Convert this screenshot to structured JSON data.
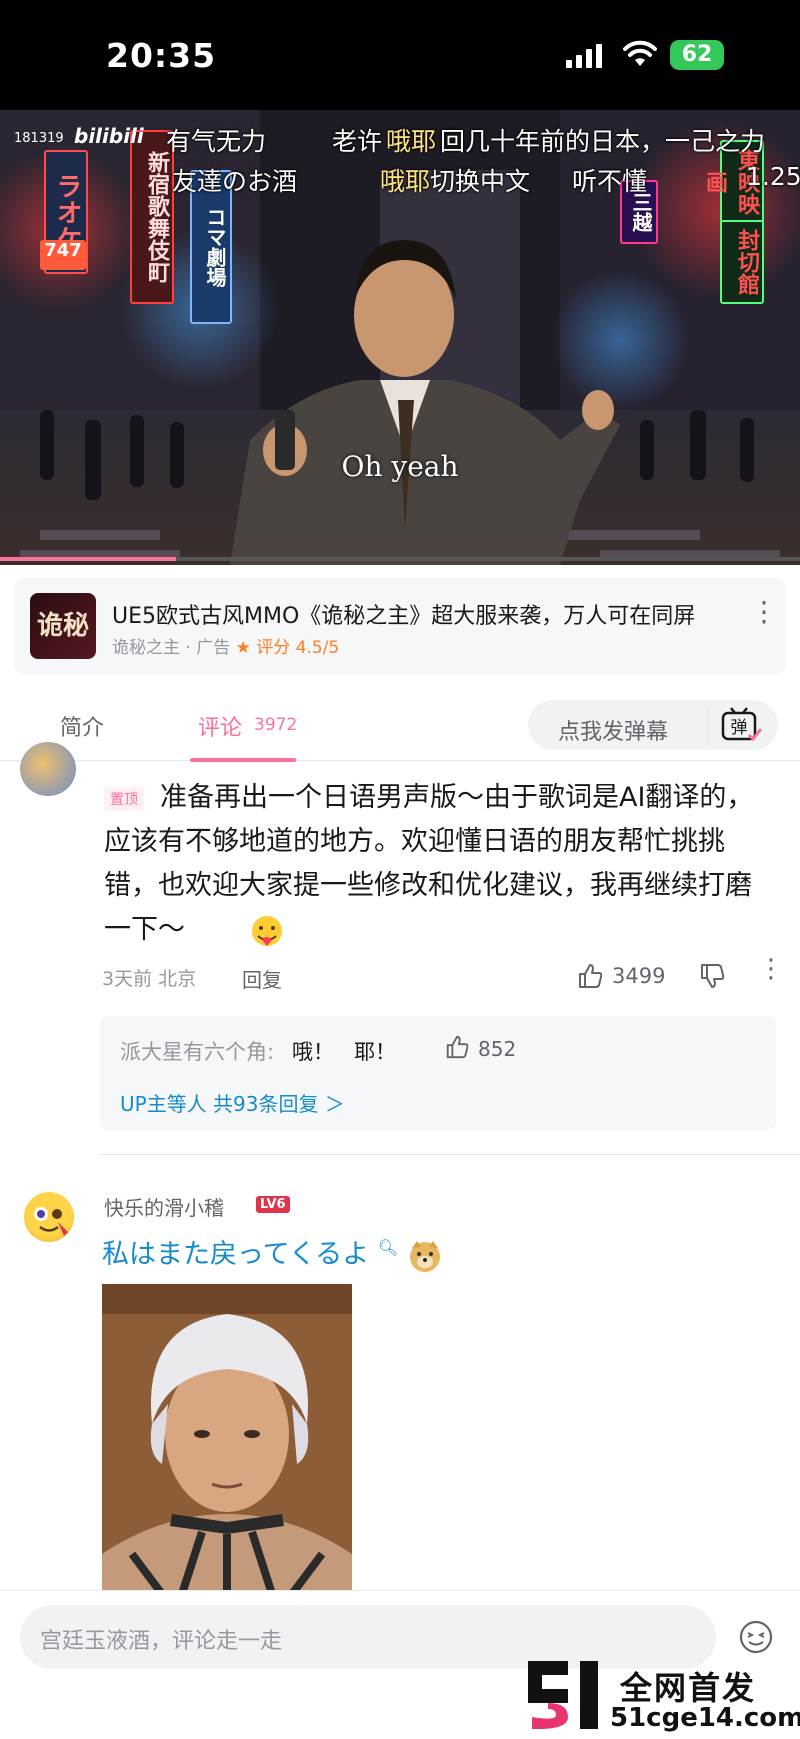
{
  "status_bar": {
    "time": "20:35",
    "battery": "62"
  },
  "video": {
    "viewer_id": "181319",
    "watermark": "bilibili",
    "subtitle": "Oh yeah",
    "danmaku": [
      {
        "text": "有气无力",
        "color": "#ffffff"
      },
      {
        "text": "老许",
        "color": "#ffffff"
      },
      {
        "text": "哦耶",
        "color": "#ffe680"
      },
      {
        "text": "回几十年前的日本，一己之力",
        "color": "#ffffff"
      },
      {
        "text": "友達のお酒",
        "color": "#ffffff"
      },
      {
        "text": "哦耶",
        "color": "#ffe680"
      },
      {
        "text": "切换中文",
        "color": "#ffffff"
      },
      {
        "text": "听不懂",
        "color": "#ffffff"
      },
      {
        "text": "1.25",
        "color": "#ffffff"
      }
    ],
    "signs": [
      "ラオケ",
      "747",
      "新宿歌舞伎町",
      "コマ劇場",
      "三越",
      "東映映画",
      "封切館"
    ],
    "progress": 0.22
  },
  "ad": {
    "logo_text": "诡秘",
    "title": "UE5欧式古风MMO《诡秘之主》超大服来袭，万人可在同屏",
    "meta": "诡秘之主 · 广告",
    "rating": "★ 评分 4.5/5"
  },
  "tabs": {
    "intro": "简介",
    "comments": "评论",
    "comment_count": "3972",
    "danmaku_placeholder": "点我发弹幕",
    "danmaku_icon_label": "弹"
  },
  "comment1": {
    "sticky_label": "置顶",
    "text": "准备再出一个日语男声版～由于歌词是AI翻译的，应该有不够地道的地方。欢迎懂日语的朋友帮忙挑挑错，也欢迎大家提一些修改和优化建议，我再继续打磨一下～",
    "meta": "3天前 北京",
    "reply": "回复",
    "likes": "3499",
    "reply_preview": {
      "author": "派大星有六个角:",
      "text": "哦！   耶！",
      "likes": "852",
      "more": "UP主等人 共93条回复 ＞"
    }
  },
  "comment2": {
    "name": "快乐的滑小稽",
    "level": "LV6",
    "text": "私はまた戻ってくるよ"
  },
  "bottom_bar": {
    "placeholder": "宫廷玉液酒，评论走一走",
    "watermark_text1": "全网首发",
    "watermark_text2": "51cge14.com"
  }
}
